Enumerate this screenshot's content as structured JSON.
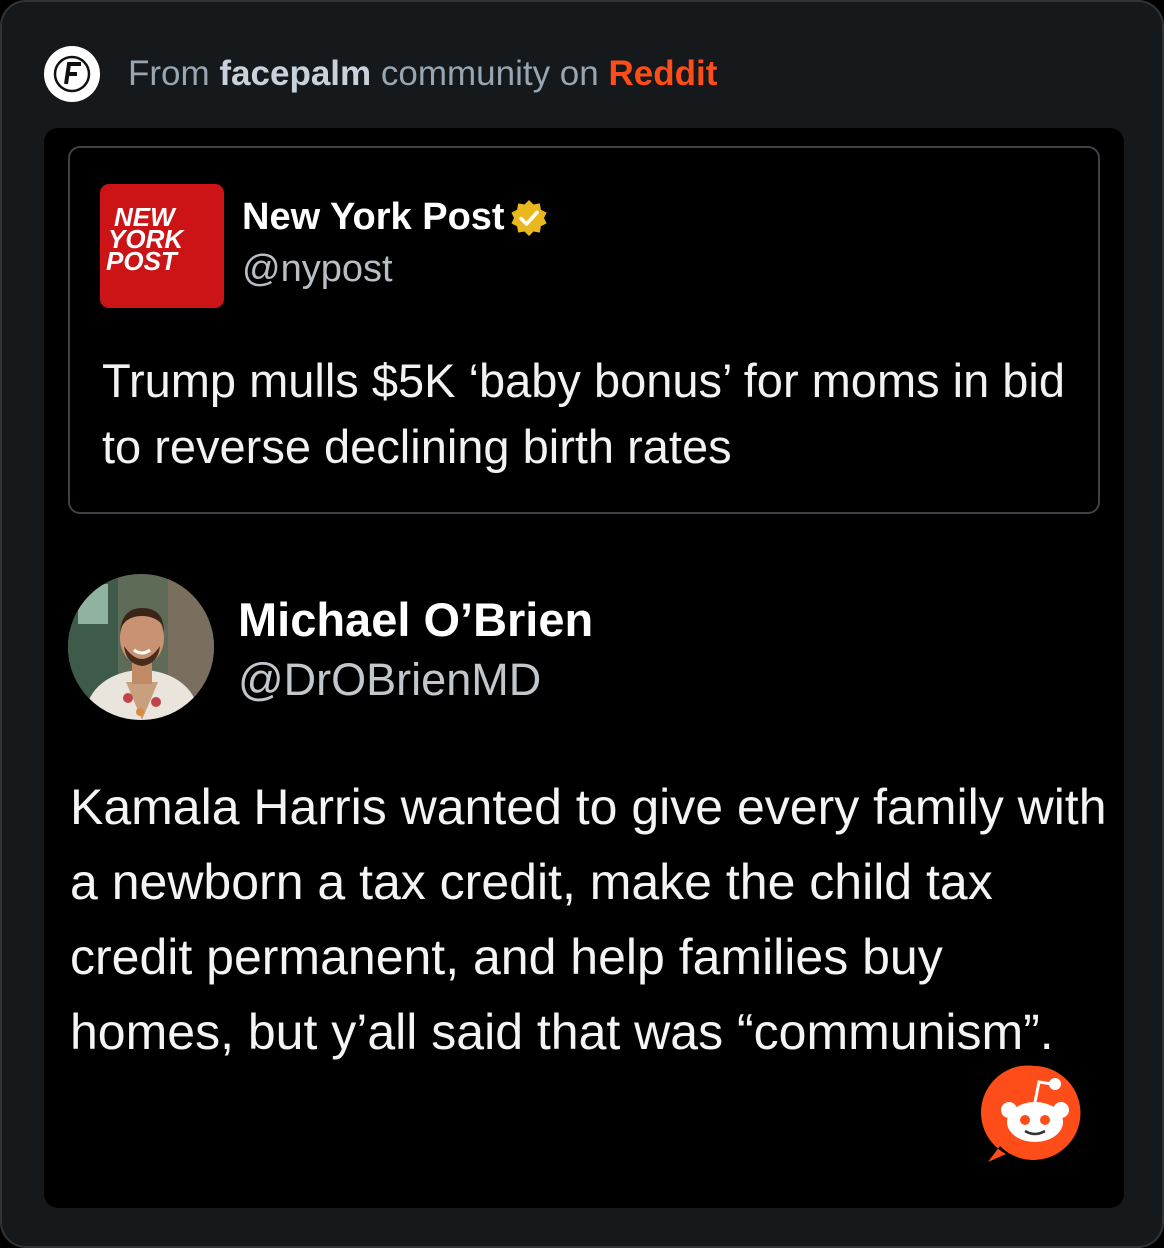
{
  "header": {
    "prefix": "From",
    "community": "facepalm",
    "middle": "community on",
    "platform": "Reddit",
    "logo_letter": "F"
  },
  "quoted_post": {
    "logo_lines": [
      "NEW",
      "YORK",
      "POST"
    ],
    "name": "New York Post",
    "handle": "@nypost",
    "text": "Trump mulls $5K ‘baby bonus’ for moms in bid to reverse declining birth rates",
    "verified_color": "#e8b81c"
  },
  "post": {
    "name": "Michael O’Brien",
    "handle": "@DrOBrienMD",
    "text": "Kamala Harris wanted to give every family with a newborn a tax credit, make the child tax credit permanent, and help families buy homes, but y’all said that was “communism”."
  },
  "colors": {
    "reddit_orange": "#ff4d19",
    "nyp_red": "#cc1417"
  }
}
